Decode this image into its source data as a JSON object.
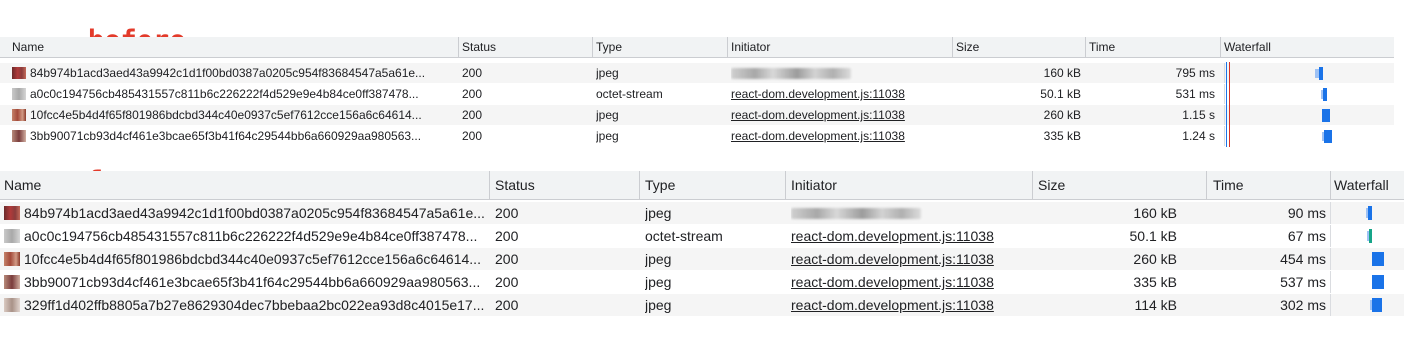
{
  "annotations": {
    "before": "before",
    "after": "after"
  },
  "columns": {
    "name": "Name",
    "status": "Status",
    "type": "Type",
    "initiator": "Initiator",
    "size": "Size",
    "time": "Time",
    "waterfall": "Waterfall"
  },
  "before": {
    "rows": [
      {
        "name": "84b974b1acd3aed43a9942c1d1f00bd0387a0205c954f83684547a5a61e...",
        "status": "200",
        "type": "jpeg",
        "initiator": "",
        "initiator_is_link": false,
        "size": "160 kB",
        "time": "795 ms"
      },
      {
        "name": "a0c0c194756cb485431557c811b6c226222f4d529e9e4b84ce0ff387478...",
        "status": "200",
        "type": "octet-stream",
        "initiator": "react-dom.development.js:11038",
        "initiator_is_link": true,
        "size": "50.1 kB",
        "time": "531 ms"
      },
      {
        "name": "10fcc4e5b4d4f65f801986bdcbd344c40e0937c5ef7612cce156a6c64614...",
        "status": "200",
        "type": "jpeg",
        "initiator": "react-dom.development.js:11038",
        "initiator_is_link": true,
        "size": "260 kB",
        "time": "1.15 s"
      },
      {
        "name": "3bb90071cb93d4cf461e3bcae65f3b41f64c29544bb6a660929aa980563...",
        "status": "200",
        "type": "jpeg",
        "initiator": "react-dom.development.js:11038",
        "initiator_is_link": true,
        "size": "335 kB",
        "time": "1.24 s"
      }
    ]
  },
  "after": {
    "rows": [
      {
        "name": "84b974b1acd3aed43a9942c1d1f00bd0387a0205c954f83684547a5a61e...",
        "status": "200",
        "type": "jpeg",
        "initiator": "",
        "initiator_is_link": false,
        "size": "160 kB",
        "time": "90 ms"
      },
      {
        "name": "a0c0c194756cb485431557c811b6c226222f4d529e9e4b84ce0ff387478...",
        "status": "200",
        "type": "octet-stream",
        "initiator": "react-dom.development.js:11038",
        "initiator_is_link": true,
        "size": "50.1 kB",
        "time": "67 ms"
      },
      {
        "name": "10fcc4e5b4d4f65f801986bdcbd344c40e0937c5ef7612cce156a6c64614...",
        "status": "200",
        "type": "jpeg",
        "initiator": "react-dom.development.js:11038",
        "initiator_is_link": true,
        "size": "260 kB",
        "time": "454 ms"
      },
      {
        "name": "3bb90071cb93d4cf461e3bcae65f3b41f64c29544bb6a660929aa980563...",
        "status": "200",
        "type": "jpeg",
        "initiator": "react-dom.development.js:11038",
        "initiator_is_link": true,
        "size": "335 kB",
        "time": "537 ms"
      },
      {
        "name": "329ff1d402ffb8805a7b27e8629304dec7bbebaa2bc022ea93d8c4015e17...",
        "status": "200",
        "type": "jpeg",
        "initiator": "react-dom.development.js:11038",
        "initiator_is_link": true,
        "size": "114 kB",
        "time": "302 ms"
      }
    ]
  },
  "colors": {
    "label": "#e33a2a",
    "waterfall_blue": "#1a73e8",
    "waterfall_light": "#9ec2f5",
    "waterfall_green": "#17a589",
    "header_bg": "#f1f3f4",
    "stripe_bg": "#f5f5f5",
    "marker_red": "#d93025",
    "marker_blue": "#1a73e8"
  }
}
